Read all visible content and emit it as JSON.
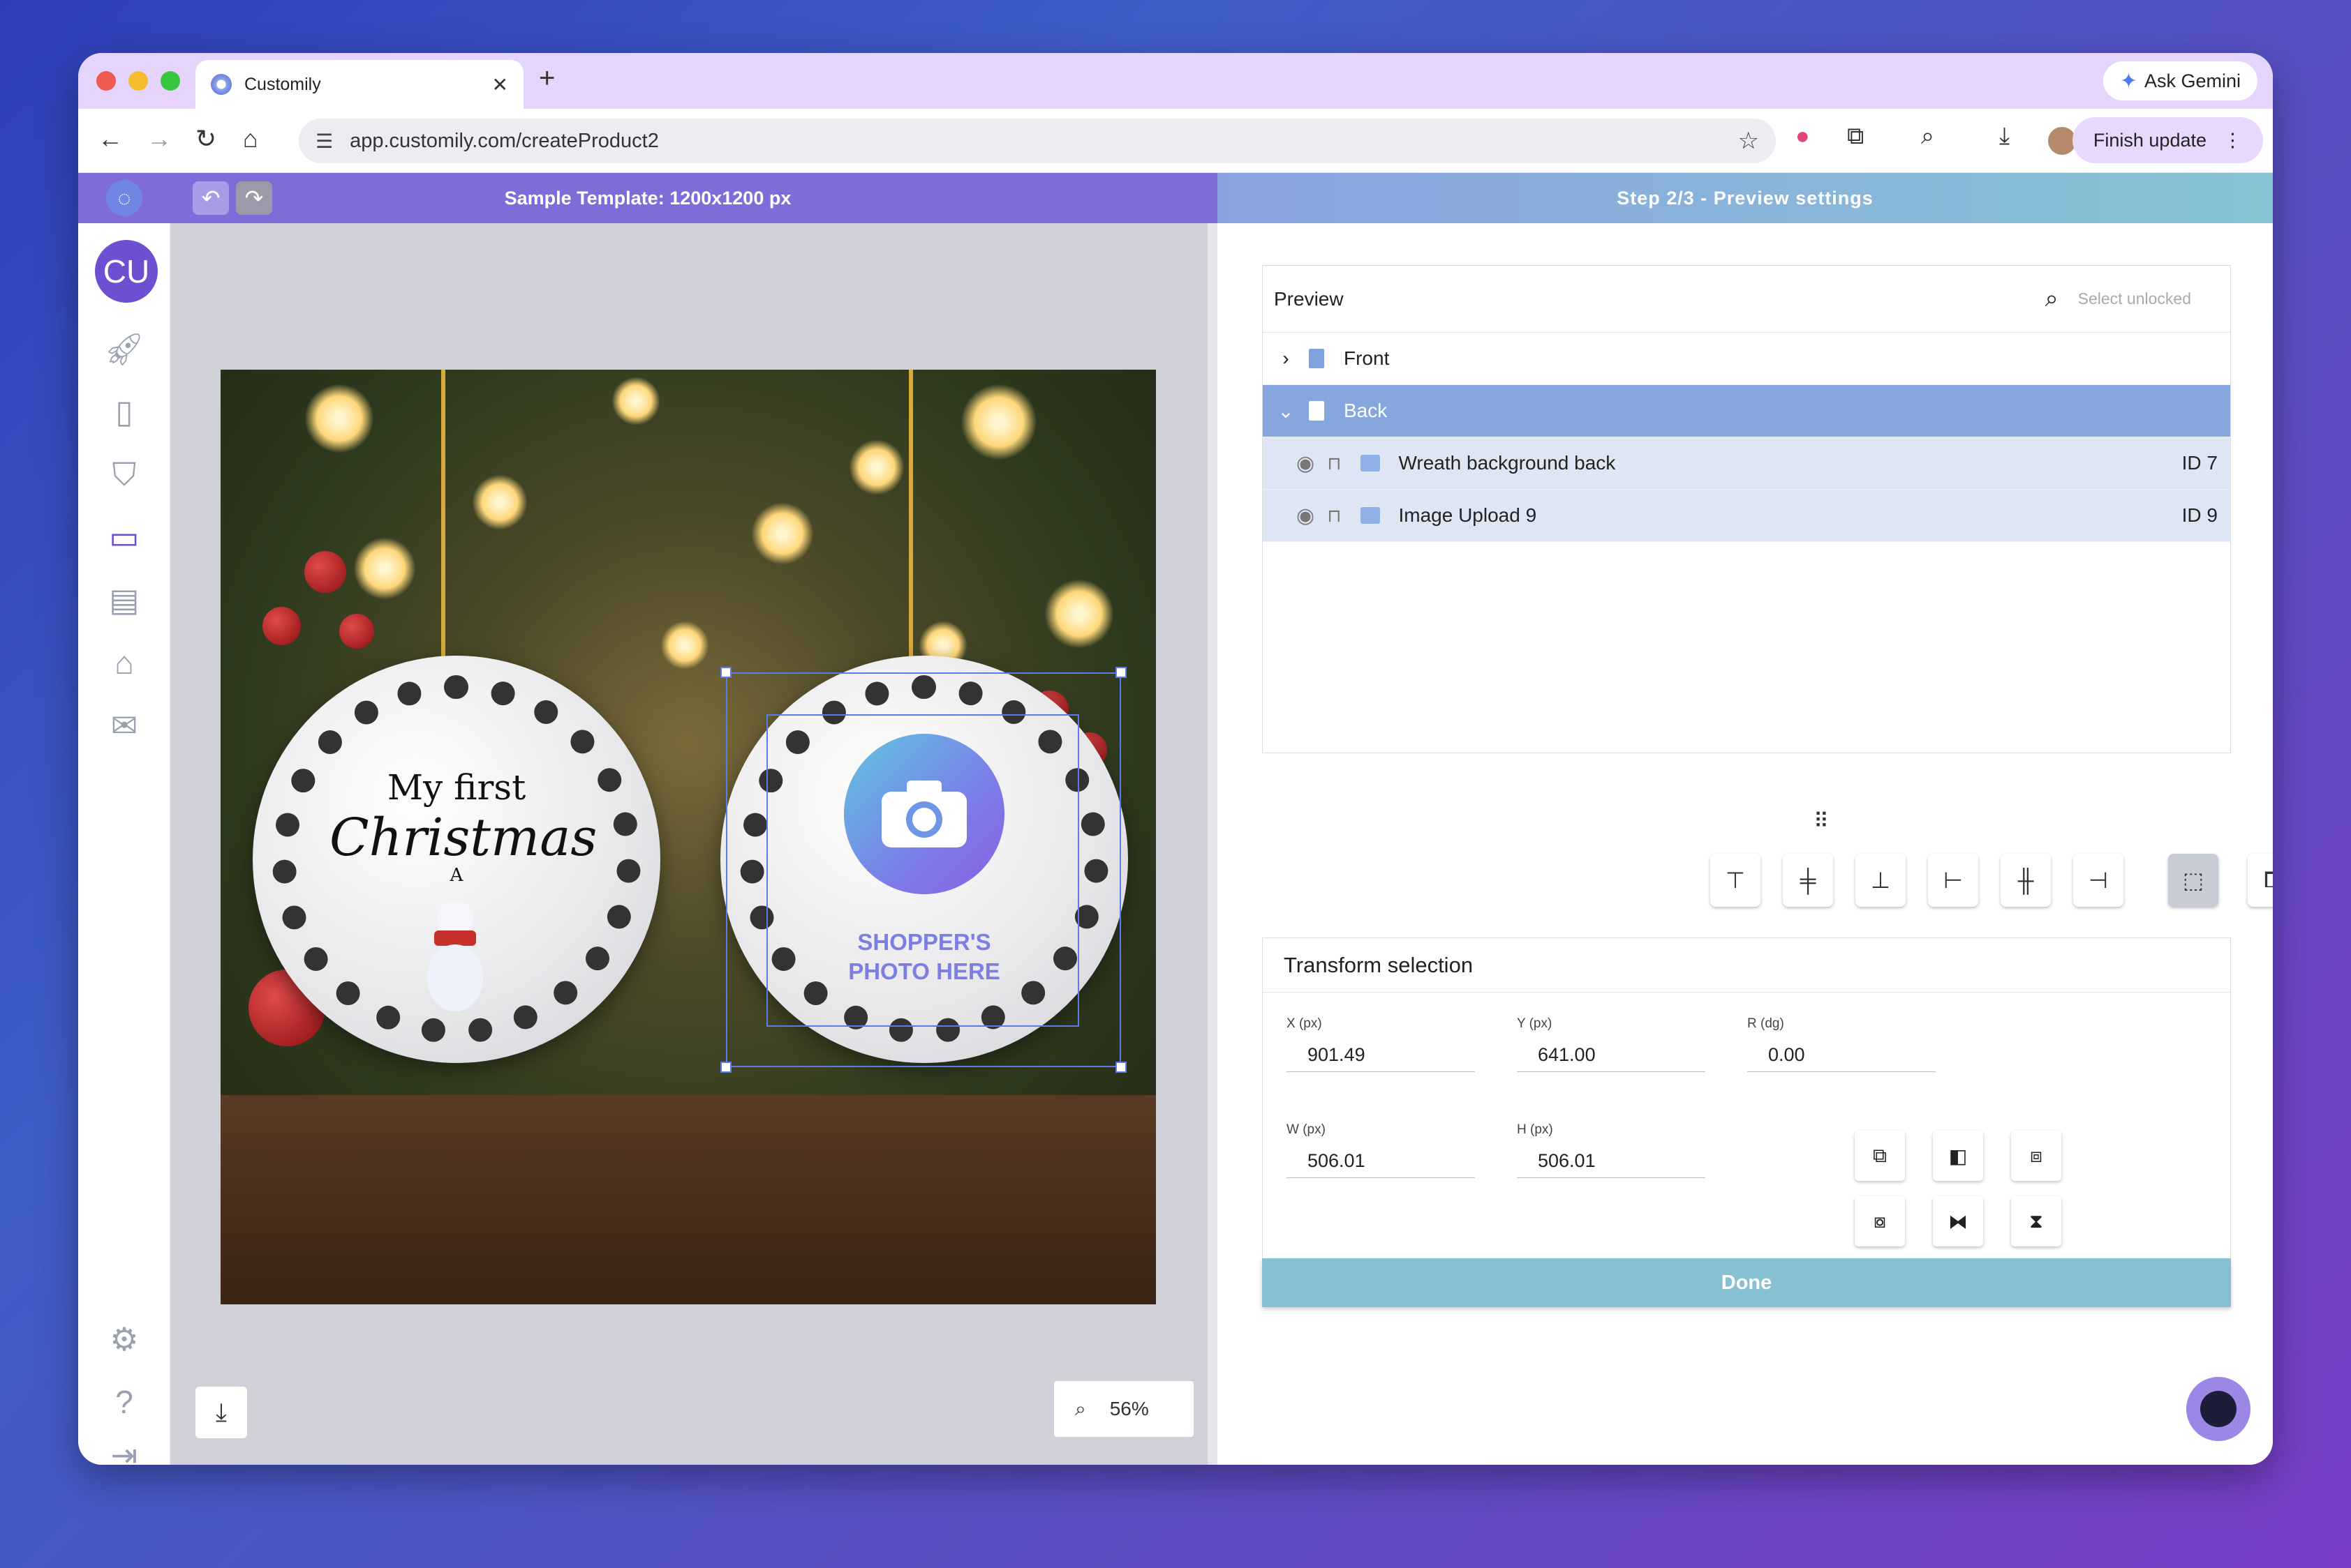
{
  "browser": {
    "tab_title": "Customily",
    "tab_close": "✕",
    "new_tab": "+",
    "ask_gemini": "Ask Gemini",
    "url": "app.customily.com/createProduct2",
    "finish_update": "Finish update"
  },
  "app": {
    "template_title": "Sample Template: 1200x1200 px",
    "step_title": "Step 2/3 - Preview settings",
    "avatar_initials": "CU",
    "undo_icon": "↶",
    "redo_icon": "↷"
  },
  "canvas": {
    "ornament_text_line1": "My first",
    "ornament_text_line2": "Christmas",
    "ornament_initial": "A",
    "placeholder_line1": "SHOPPER'S",
    "placeholder_line2": "PHOTO HERE",
    "zoom": "56%"
  },
  "preview": {
    "header": "Preview",
    "select_unlocked": "Select unlocked",
    "front": "Front",
    "back": "Back",
    "layers": [
      {
        "name": "Wreath background back",
        "id": "ID 7"
      },
      {
        "name": "Image Upload 9",
        "id": "ID 9"
      }
    ]
  },
  "transform": {
    "header": "Transform selection",
    "x_label": "X (px)",
    "x_value": "901.49",
    "y_label": "Y (px)",
    "y_value": "641.00",
    "r_label": "R (dg)",
    "r_value": "0.00",
    "w_label": "W (px)",
    "w_value": "506.01",
    "h_label": "H (px)",
    "h_value": "506.01"
  },
  "done_label": "Done",
  "colors": {
    "accent": "#7f6cd9",
    "step_header": "#86c4d4",
    "done": "#86c0d2",
    "selected_row": "#86a6de"
  }
}
